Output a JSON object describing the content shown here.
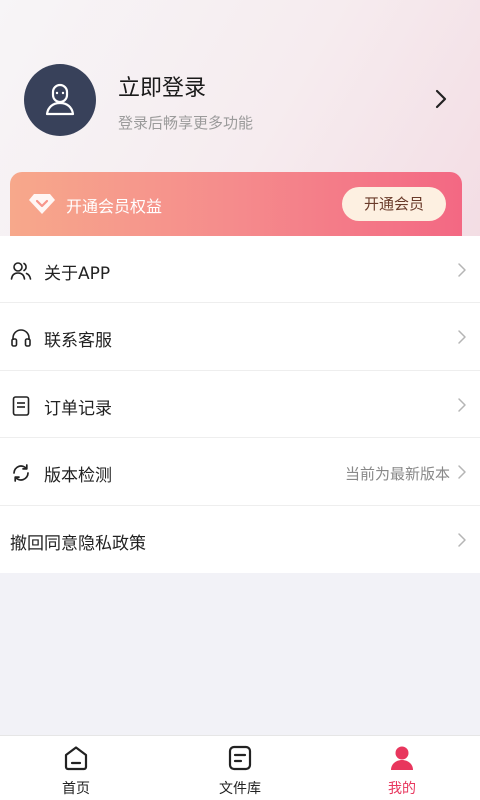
{
  "profile": {
    "title": "立即登录",
    "subtitle": "登录后畅享更多功能",
    "avatar_icon": "user-avatar-icon",
    "chevron_icon": "chevron-right-icon"
  },
  "vip": {
    "icon": "diamond-icon",
    "label": "开通会员权益",
    "button_label": "开通会员",
    "gradient_start": "#f7a88b",
    "gradient_end": "#f36883"
  },
  "menu": {
    "items": [
      {
        "label": "关于APP",
        "icon": "users-icon",
        "value": ""
      },
      {
        "label": "联系客服",
        "icon": "headset-icon",
        "value": ""
      },
      {
        "label": "订单记录",
        "icon": "document-icon",
        "value": ""
      },
      {
        "label": "版本检测",
        "icon": "refresh-icon",
        "value": "当前为最新版本"
      },
      {
        "label": "撤回同意隐私政策",
        "icon": "",
        "value": ""
      }
    ]
  },
  "tabbar": {
    "tabs": [
      {
        "label": "首页",
        "icon": "home-icon",
        "active": false
      },
      {
        "label": "文件库",
        "icon": "file-library-icon",
        "active": false
      },
      {
        "label": "我的",
        "icon": "profile-icon",
        "active": true
      }
    ],
    "active_color": "#e8365d"
  }
}
